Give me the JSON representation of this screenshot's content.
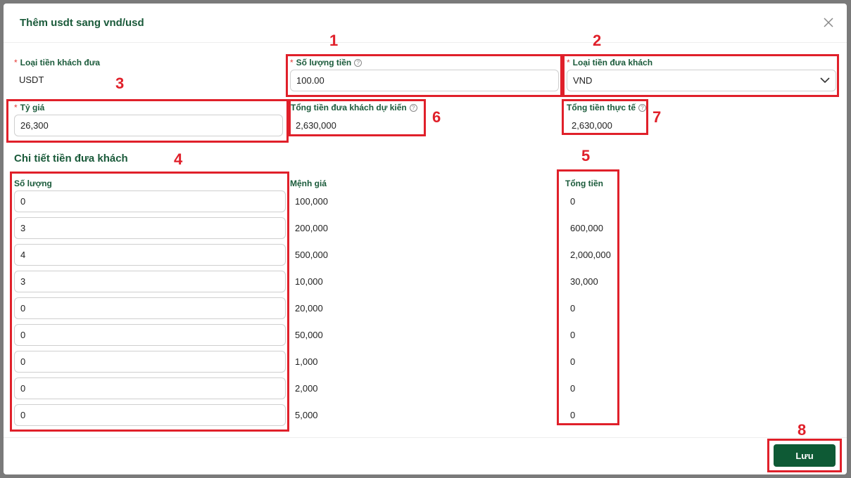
{
  "modal": {
    "title": "Thêm usdt sang vnd/usd",
    "close_icon": "close-icon"
  },
  "form": {
    "currency_given": {
      "label": "Loại tiền khách đưa",
      "value": "USDT"
    },
    "amount": {
      "label": "Số lượng tiền",
      "value": "100.00"
    },
    "currency_return": {
      "label": "Loại tiền đưa khách",
      "value": "VND"
    },
    "rate": {
      "label": "Tỷ giá",
      "value": "26,300"
    },
    "expected_total": {
      "label": "Tổng tiền đưa khách dự kiến",
      "value": "2,630,000"
    },
    "actual_total": {
      "label": "Tổng tiền thực tế",
      "value": "2,630,000"
    }
  },
  "details": {
    "title": "Chi tiết tiền đưa khách",
    "headers": {
      "quantity": "Số lượng",
      "denomination": "Mệnh giá",
      "total": "Tổng tiền"
    },
    "rows": [
      {
        "quantity": "0",
        "denomination": "100,000",
        "total": "0"
      },
      {
        "quantity": "3",
        "denomination": "200,000",
        "total": "600,000"
      },
      {
        "quantity": "4",
        "denomination": "500,000",
        "total": "2,000,000"
      },
      {
        "quantity": "3",
        "denomination": "10,000",
        "total": "30,000"
      },
      {
        "quantity": "0",
        "denomination": "20,000",
        "total": "0"
      },
      {
        "quantity": "0",
        "denomination": "50,000",
        "total": "0"
      },
      {
        "quantity": "0",
        "denomination": "1,000",
        "total": "0"
      },
      {
        "quantity": "0",
        "denomination": "2,000",
        "total": "0"
      },
      {
        "quantity": "0",
        "denomination": "5,000",
        "total": "0"
      }
    ]
  },
  "footer": {
    "save_label": "Lưu"
  },
  "annotations": [
    "1",
    "2",
    "3",
    "4",
    "5",
    "6",
    "7",
    "8"
  ],
  "colors": {
    "brand": "#0e5a35",
    "label": "#1a5a3a",
    "annotation": "#e0202a",
    "required": "#e53935"
  }
}
